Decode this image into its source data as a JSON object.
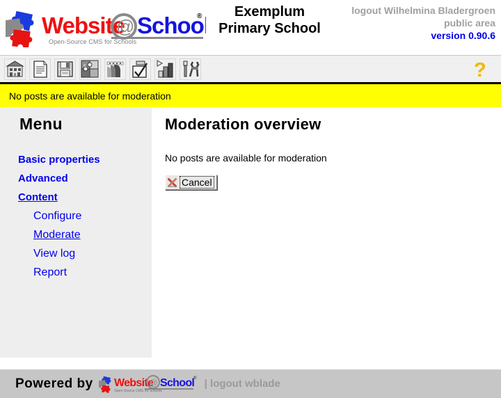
{
  "header": {
    "logo": {
      "word_1": "Websi",
      "word_1b": "te",
      "at": "@",
      "word_2": "School",
      "tagline": "Open-Source CMS for Schools",
      "registered": "®"
    },
    "school_name_line1": "Exemplum",
    "school_name_line2": "Primary School",
    "logout_user": "logout Wilhelmina Bladergroen",
    "area": "public area",
    "version": "version 0.90.6"
  },
  "toolbar": {
    "icons": [
      {
        "name": "school-building-icon",
        "title": "School"
      },
      {
        "name": "page-document-icon",
        "title": "Page"
      },
      {
        "name": "floppy-save-icon",
        "title": "Save"
      },
      {
        "name": "modules-puzzle-icon",
        "title": "Modules"
      },
      {
        "name": "users-faces-icon",
        "title": "Users"
      },
      {
        "name": "checklist-icon",
        "title": "Tasks"
      },
      {
        "name": "bar-chart-icon",
        "title": "Statistics"
      },
      {
        "name": "tools-wrench-icon",
        "title": "Tools"
      }
    ],
    "help": {
      "name": "help-question-icon",
      "glyph": "?",
      "color": "#f0b800"
    }
  },
  "message_bar": {
    "text": "No posts are available for moderation",
    "background": "#ffff00"
  },
  "sidebar": {
    "title": "Menu",
    "items": [
      {
        "label": "Basic properties",
        "level": 1,
        "current": false
      },
      {
        "label": "Advanced",
        "level": 1,
        "current": false
      },
      {
        "label": "Content",
        "level": 1,
        "current": true
      },
      {
        "label": "Configure",
        "level": 2,
        "current": false
      },
      {
        "label": "Moderate",
        "level": 2,
        "current": true
      },
      {
        "label": "View log",
        "level": 2,
        "current": false
      },
      {
        "label": "Report",
        "level": 2,
        "current": false
      }
    ]
  },
  "main": {
    "title": "Moderation overview",
    "body_text": "No posts are available for moderation",
    "cancel_label": "Cancel"
  },
  "footer": {
    "powered_by": "Powered by",
    "separator_logout": "| logout wblade"
  },
  "colors": {
    "link": "#0000ee",
    "logo_red": "#ee1111",
    "logo_blue": "#1414dd",
    "logo_gray": "#808080",
    "accent_yellow": "#ffff00",
    "footer_bg": "#c6c6c6",
    "sidebar_bg": "#eeeeee"
  }
}
